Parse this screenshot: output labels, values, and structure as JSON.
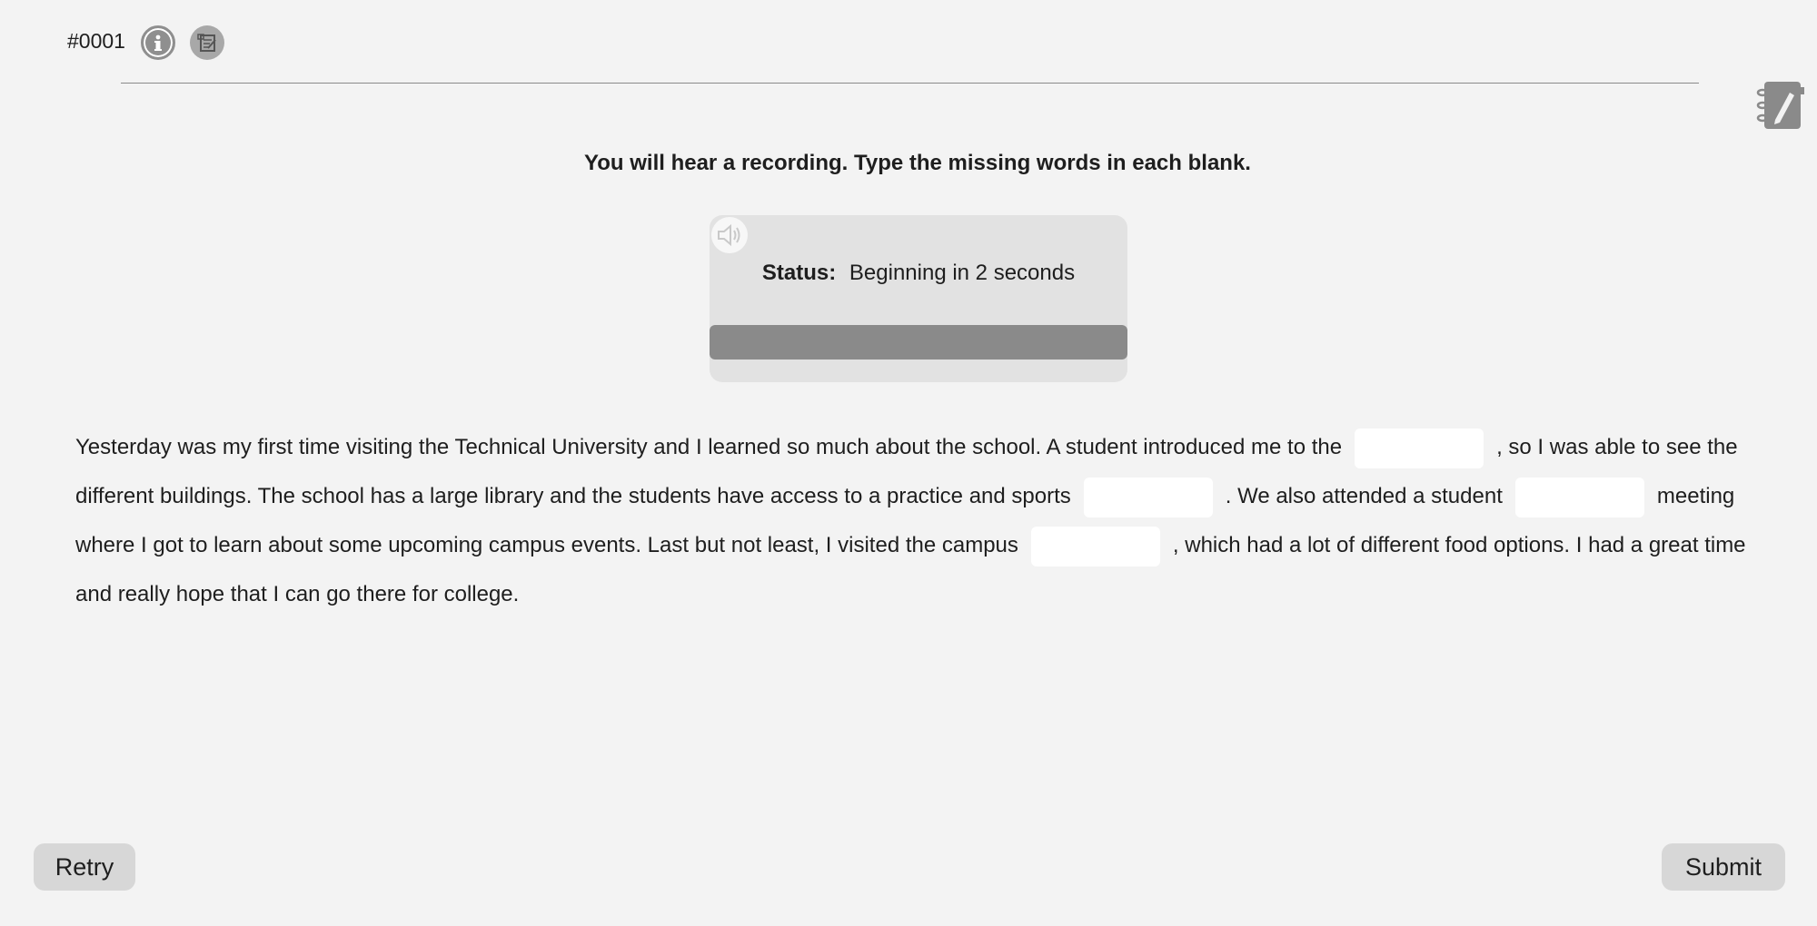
{
  "header": {
    "item_id": "#0001",
    "icons": [
      "info-icon",
      "notes-icon",
      "notepad-icon"
    ]
  },
  "instruction": "You will hear a recording. Type the missing words in each blank.",
  "player": {
    "speaker_icon": "speaker-icon",
    "status_label": "Status:",
    "status_text": "Beginning in 2 seconds",
    "progress": 1.0
  },
  "passage": {
    "segments": [
      "Yesterday was my first time visiting the Technical University and I learned so much about the school. A student introduced me to the",
      ", so I was able to see the different buildings. The school has a large library and the students have access to a practice and sports",
      ". We also attended a student",
      "meeting where I got to learn about some upcoming campus events. Last but not least, I visited the campus",
      ", which had a lot of different food options. I had a great time and really hope that I can go there for college."
    ],
    "blanks": [
      {
        "value": "",
        "placeholder": ""
      },
      {
        "value": "",
        "placeholder": ""
      },
      {
        "value": "",
        "placeholder": ""
      },
      {
        "value": "",
        "placeholder": ""
      }
    ]
  },
  "buttons": {
    "retry": "Retry",
    "submit": "Submit"
  }
}
